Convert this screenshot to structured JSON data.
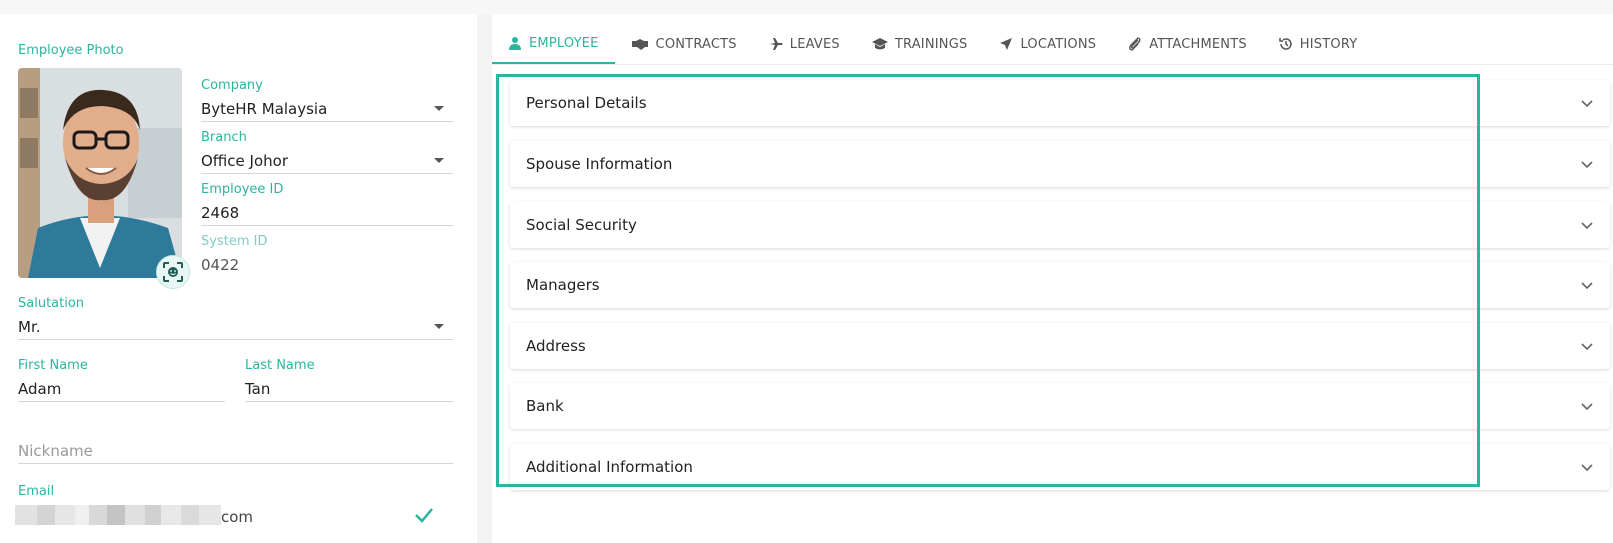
{
  "left": {
    "photo_label": "Employee Photo",
    "company": {
      "label": "Company",
      "value": "ByteHR Malaysia"
    },
    "branch": {
      "label": "Branch",
      "value": "Office Johor"
    },
    "employee_id": {
      "label": "Employee ID",
      "value": "2468"
    },
    "system_id": {
      "label": "System ID",
      "value": "0422"
    },
    "salutation": {
      "label": "Salutation",
      "value": "Mr."
    },
    "first_name": {
      "label": "First Name",
      "value": "Adam"
    },
    "last_name": {
      "label": "Last Name",
      "value": "Tan"
    },
    "nickname": {
      "placeholder": "Nickname"
    },
    "email": {
      "label": "Email",
      "value_suffix": "com"
    }
  },
  "tabs": [
    {
      "label": "EMPLOYEE",
      "icon": "person-icon"
    },
    {
      "label": "CONTRACTS",
      "icon": "handshake-icon"
    },
    {
      "label": "LEAVES",
      "icon": "plane-icon"
    },
    {
      "label": "TRAININGS",
      "icon": "graduation-cap-icon"
    },
    {
      "label": "LOCATIONS",
      "icon": "location-arrow-icon"
    },
    {
      "label": "ATTACHMENTS",
      "icon": "paperclip-icon"
    },
    {
      "label": "HISTORY",
      "icon": "history-icon"
    }
  ],
  "sections": [
    {
      "title": "Personal Details"
    },
    {
      "title": "Spouse Information"
    },
    {
      "title": "Social Security"
    },
    {
      "title": "Managers"
    },
    {
      "title": "Address"
    },
    {
      "title": "Bank"
    },
    {
      "title": "Additional Information"
    }
  ],
  "colors": {
    "accent": "#2bb59f"
  }
}
